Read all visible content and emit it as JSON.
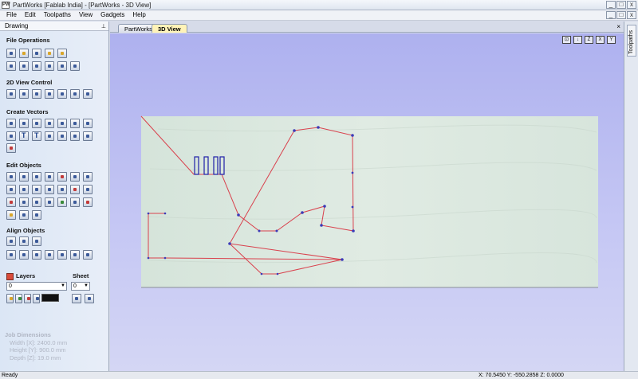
{
  "window": {
    "app_icon": "PW",
    "title": "PartWorks [Fablab India] - [PartWorks - 3D View]",
    "controls": [
      "_",
      "□",
      "x"
    ],
    "doc_controls": [
      "_",
      "□",
      "x"
    ]
  },
  "menu": [
    "File",
    "Edit",
    "Toolpaths",
    "View",
    "Gadgets",
    "Help"
  ],
  "left_panel": {
    "header": "Drawing",
    "pin": "⊥",
    "sections": {
      "file_operations": "File Operations",
      "view_control": "2D View Control",
      "create_vectors": "Create Vectors",
      "edit_objects": "Edit Objects",
      "align_objects": "Align Objects"
    },
    "layers_label": "Layers",
    "sheet_label": "Sheet",
    "layer_value": "0",
    "sheet_value": "0",
    "job_dimensions": {
      "title": "Job Dimensions",
      "width": "Width  [X]: 2400.0 mm",
      "height": "Height [Y]: 900.0 mm",
      "depth": "Depth  [Z]: 19.0 mm"
    }
  },
  "tabs": [
    {
      "label": "PartWorks",
      "active": false
    },
    {
      "label": "3D View",
      "active": true
    }
  ],
  "view_icons": [
    "⊡",
    "↓",
    "Z",
    "X",
    "Y"
  ],
  "right_panel_tab": "Toolpaths",
  "status": {
    "left": "Ready",
    "coords": "X: 70.5450 Y: -550.2858 Z: 0.0000"
  },
  "colors": {
    "vector_red": "#d9414d",
    "node_blue": "#3b3bb8",
    "slot_blue": "#1f1fa8",
    "board_green": "#dde9e1",
    "viewport_blue": "#b3b5f0"
  }
}
